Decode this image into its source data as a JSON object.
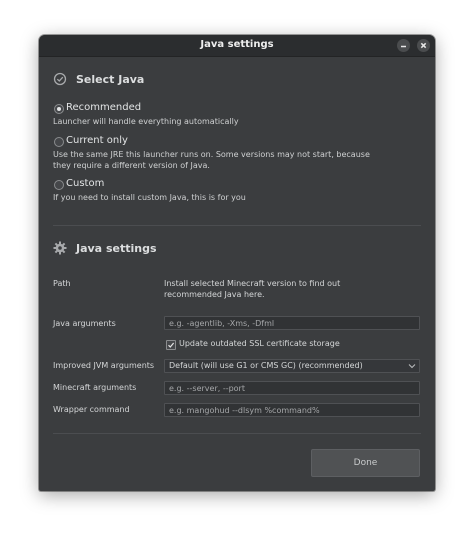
{
  "window": {
    "title": "Java settings"
  },
  "select_java": {
    "title": "Select Java",
    "icon": "check-circle-icon",
    "options": [
      {
        "label": "Recommended",
        "description": "Launcher will handle everything automatically",
        "selected": true
      },
      {
        "label": "Current only",
        "description": "Use the same JRE this launcher runs on. Some versions may not start, because they require a different version of Java.",
        "selected": false
      },
      {
        "label": "Custom",
        "description": "If you need to install custom Java, this is for you",
        "selected": false
      }
    ]
  },
  "java_settings": {
    "title": "Java settings",
    "icon": "gear-icon",
    "path": {
      "label": "Path",
      "value": "Install selected Minecraft version to find out recommended Java here."
    },
    "java_arguments": {
      "label": "Java arguments",
      "placeholder": "e.g. -agentlib, -Xms, -Dfml",
      "value": ""
    },
    "ssl_checkbox": {
      "label": "Update outdated SSL certificate storage",
      "checked": true
    },
    "improved_jvm": {
      "label": "Improved JVM arguments",
      "selected": "Default (will use G1 or CMS GC) (recommended)"
    },
    "minecraft_arguments": {
      "label": "Minecraft arguments",
      "placeholder": "e.g. --server, --port",
      "value": ""
    },
    "wrapper_command": {
      "label": "Wrapper command",
      "placeholder": "e.g. mangohud --dlsym %command%",
      "value": ""
    }
  },
  "footer": {
    "done_label": "Done"
  },
  "colors": {
    "window_bg": "#3b3d3f",
    "titlebar_bg": "#2b2d2f",
    "input_bg": "#313335",
    "button_bg": "#505254"
  }
}
